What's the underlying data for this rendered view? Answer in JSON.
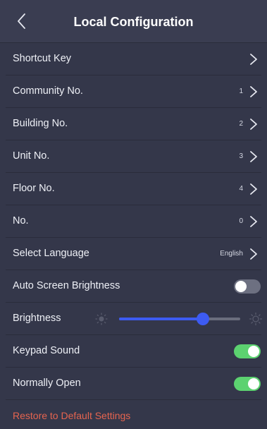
{
  "header": {
    "title": "Local Configuration",
    "back_icon": "chevron-left-icon"
  },
  "settings": {
    "shortcut_key": {
      "label": "Shortcut Key"
    },
    "community_no": {
      "label": "Community No.",
      "value": "1"
    },
    "building_no": {
      "label": "Building No.",
      "value": "2"
    },
    "unit_no": {
      "label": "Unit No.",
      "value": "3"
    },
    "floor_no": {
      "label": "Floor No.",
      "value": "4"
    },
    "no": {
      "label": "No.",
      "value": "0"
    },
    "select_language": {
      "label": "Select Language",
      "value": "English"
    },
    "auto_screen_brightness": {
      "label": "Auto Screen Brightness",
      "enabled": false
    },
    "brightness": {
      "label": "Brightness",
      "level": 0.69
    },
    "keypad_sound": {
      "label": "Keypad Sound",
      "enabled": true
    },
    "normally_open": {
      "label": "Normally Open",
      "enabled": true
    }
  },
  "footer": {
    "restore_label": "Restore to Default Settings"
  },
  "colors": {
    "background": "#34374a",
    "header": "#3a3d51",
    "accent_blue": "#3d5bf2",
    "toggle_on": "#5cd270",
    "toggle_off": "#6d7081",
    "restore_text": "#e5644f"
  }
}
